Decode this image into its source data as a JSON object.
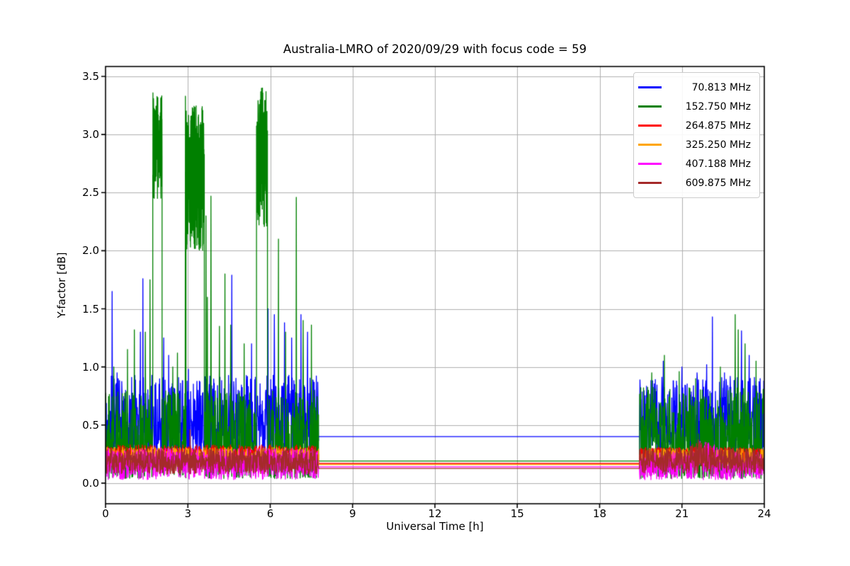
{
  "figure": {
    "background": "#ffffff",
    "plot_background": "#ffffff",
    "spine_color": "#000000"
  },
  "chart_data": {
    "type": "line",
    "title": "Australia-LMRO of 2020/09/29 with focus code = 59",
    "xlabel": "Universal Time [h]",
    "ylabel": "Y-factor [dB]",
    "xlim": [
      0,
      24
    ],
    "ylim": [
      -0.177,
      3.585
    ],
    "xticks": [
      0,
      3,
      6,
      9,
      12,
      15,
      18,
      21,
      24
    ],
    "xticklabels": [
      "0",
      "3",
      "6",
      "9",
      "12",
      "15",
      "18",
      "21",
      "24"
    ],
    "yticks": [
      0.0,
      0.5,
      1.0,
      1.5,
      2.0,
      2.5,
      3.0,
      3.5
    ],
    "yticklabels": [
      "0.0",
      "0.5",
      "1.0",
      "1.5",
      "2.0",
      "2.5",
      "3.0",
      "3.5"
    ],
    "grid": true,
    "grid_color": "#b0b0b0",
    "legend_position": "upper right",
    "gap_interval_hours": [
      7.76,
      19.45
    ],
    "series": [
      {
        "name": "70.813 MHz",
        "color": "#0000ff",
        "flat_value": 0.4,
        "segments": [
          {
            "type": "noise",
            "t0": 0,
            "t1": 7.76,
            "lo": 0.24,
            "hi": 0.93,
            "p": 1.35
          },
          {
            "type": "flat",
            "t0": 7.76,
            "t1": 19.45,
            "v": 0.4
          },
          {
            "type": "noise",
            "t0": 19.45,
            "t1": 24,
            "lo": 0.24,
            "hi": 0.92,
            "p": 1.5
          }
        ],
        "spikes": [
          [
            0.24,
            1.65
          ],
          [
            0.42,
            0.95
          ],
          [
            1.27,
            1.3
          ],
          [
            1.36,
            1.76
          ],
          [
            2.12,
            1.25
          ],
          [
            2.3,
            1.1
          ],
          [
            3.02,
            0.98
          ],
          [
            4.6,
            1.79
          ],
          [
            5.32,
            1.2
          ],
          [
            5.92,
            1.5
          ],
          [
            6.15,
            1.45
          ],
          [
            6.52,
            1.38
          ],
          [
            6.78,
            1.25
          ],
          [
            7.12,
            1.45
          ],
          [
            7.36,
            1.3
          ],
          [
            20.32,
            1.05
          ],
          [
            21.0,
            1.0
          ],
          [
            21.55,
            0.95
          ],
          [
            21.9,
            1.02
          ],
          [
            22.11,
            1.43
          ],
          [
            22.55,
            0.95
          ],
          [
            23.17,
            1.31
          ],
          [
            23.45,
            1.1
          ],
          [
            23.85,
            0.9
          ]
        ]
      },
      {
        "name": "152.750 MHz",
        "color": "#008000",
        "flat_value": 0.19,
        "segments": [
          {
            "type": "noise",
            "t0": 0,
            "t1": 1.72,
            "lo": 0.04,
            "hi": 0.8,
            "p": 1.4
          },
          {
            "type": "burst",
            "t0": 1.72,
            "t1": 2.06,
            "lo": 2.45,
            "hi": 3.36
          },
          {
            "type": "noise",
            "t0": 2.06,
            "t1": 2.93,
            "lo": 0.04,
            "hi": 0.8,
            "p": 1.4
          },
          {
            "type": "burst",
            "t0": 2.93,
            "t1": 3.6,
            "lo": 2.0,
            "hi": 3.25
          },
          {
            "type": "noise",
            "t0": 3.6,
            "t1": 5.5,
            "lo": 0.04,
            "hi": 0.8,
            "p": 1.4
          },
          {
            "type": "burst",
            "t0": 5.5,
            "t1": 5.9,
            "lo": 2.2,
            "hi": 3.41
          },
          {
            "type": "noise",
            "t0": 5.9,
            "t1": 7.76,
            "lo": 0.04,
            "hi": 0.8,
            "p": 1.4
          },
          {
            "type": "flat",
            "t0": 7.76,
            "t1": 19.45,
            "v": 0.19
          },
          {
            "type": "noise",
            "t0": 19.45,
            "t1": 24,
            "lo": 0.04,
            "hi": 0.83,
            "p": 1.4
          }
        ],
        "spikes": [
          [
            0.3,
            1.0
          ],
          [
            0.8,
            1.15
          ],
          [
            1.05,
            1.32
          ],
          [
            1.45,
            1.3
          ],
          [
            1.62,
            1.75
          ],
          [
            2.45,
            1.0
          ],
          [
            2.62,
            1.12
          ],
          [
            2.91,
            3.33
          ],
          [
            3.66,
            2.3
          ],
          [
            3.71,
            1.6
          ],
          [
            3.84,
            2.47
          ],
          [
            4.15,
            1.35
          ],
          [
            4.35,
            1.8
          ],
          [
            4.56,
            1.36
          ],
          [
            5.05,
            1.2
          ],
          [
            6.3,
            2.1
          ],
          [
            6.56,
            1.3
          ],
          [
            6.95,
            2.46
          ],
          [
            7.2,
            1.4
          ],
          [
            7.5,
            1.36
          ],
          [
            19.9,
            0.95
          ],
          [
            20.36,
            1.1
          ],
          [
            20.9,
            0.96
          ],
          [
            21.5,
            0.9
          ],
          [
            22.4,
            1.0
          ],
          [
            22.94,
            1.45
          ],
          [
            23.05,
            1.32
          ],
          [
            23.3,
            1.2
          ],
          [
            23.7,
            1.05
          ]
        ]
      },
      {
        "name": "264.875 MHz",
        "color": "#ff0000",
        "flat_value": 0.17,
        "segments": [
          {
            "type": "noise",
            "t0": 0,
            "t1": 7.76,
            "lo": 0.16,
            "hi": 0.33,
            "p": 1.1
          },
          {
            "type": "flat",
            "t0": 7.76,
            "t1": 19.45,
            "v": 0.17
          },
          {
            "type": "noise",
            "t0": 19.45,
            "t1": 24,
            "lo": 0.16,
            "hi": 0.31,
            "p": 1.1
          }
        ],
        "spikes": []
      },
      {
        "name": "325.250 MHz",
        "color": "#ffa500",
        "flat_value": 0.16,
        "segments": [
          {
            "type": "noise",
            "t0": 0,
            "t1": 7.76,
            "lo": 0.15,
            "hi": 0.31,
            "p": 1.1
          },
          {
            "type": "flat",
            "t0": 7.76,
            "t1": 19.45,
            "v": 0.16
          },
          {
            "type": "noise",
            "t0": 19.45,
            "t1": 24,
            "lo": 0.15,
            "hi": 0.3,
            "p": 1.1
          }
        ],
        "spikes": []
      },
      {
        "name": "407.188 MHz",
        "color": "#ff00ff",
        "flat_value": 0.14,
        "segments": [
          {
            "type": "noise",
            "t0": 0,
            "t1": 7.76,
            "lo": 0.03,
            "hi": 0.3,
            "p": 1.0
          },
          {
            "type": "flat",
            "t0": 7.76,
            "t1": 19.45,
            "v": 0.14
          },
          {
            "type": "noise",
            "t0": 19.45,
            "t1": 24,
            "lo": 0.03,
            "hi": 0.27,
            "p": 1.0,
            "bumps": [
              {
                "t0": 21.35,
                "tc": 21.8,
                "t1": 22.55,
                "add": 0.13
              }
            ]
          }
        ],
        "spikes": []
      },
      {
        "name": "609.875 MHz",
        "color": "#a52a2a",
        "flat_value": 0.127,
        "segments": [
          {
            "type": "noise",
            "t0": 0,
            "t1": 7.76,
            "lo": 0.08,
            "hi": 0.295,
            "p": 1.0
          },
          {
            "type": "flat",
            "t0": 7.76,
            "t1": 19.45,
            "v": 0.127
          },
          {
            "type": "noise",
            "t0": 19.45,
            "t1": 24,
            "lo": 0.08,
            "hi": 0.3,
            "p": 1.0,
            "bumps": [
              {
                "t0": 21.15,
                "tc": 21.6,
                "t1": 22.35,
                "add": 0.09
              }
            ]
          }
        ],
        "spikes": [
          [
            3.08,
            0.46
          ]
        ]
      }
    ]
  }
}
